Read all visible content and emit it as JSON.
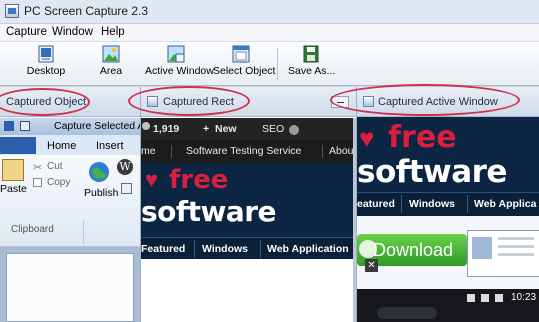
{
  "window": {
    "title": "PC Screen Capture 2.3"
  },
  "menu": {
    "items": [
      "Capture",
      "Window",
      "Help"
    ]
  },
  "toolbar": {
    "desktop_label": "Desktop",
    "area_label": "Area",
    "active_window_label": "Active Window",
    "select_object_label": "Select Object",
    "save_as_label": "Save As..."
  },
  "panels": {
    "captured_object": {
      "header": "Captured Object",
      "word": {
        "title": "Capture Selected A",
        "tabs": [
          "Home",
          "Insert"
        ],
        "clipboard": {
          "paste": "Paste",
          "cut": "Cut",
          "copy": "Copy",
          "group": "Clipboard"
        },
        "publish": "Publish"
      }
    },
    "captured_rect": {
      "header": "Captured Rect",
      "site": {
        "top": {
          "count": "1,919",
          "new": "New",
          "seo": "SEO"
        },
        "nav": [
          "me",
          "Software Testing Service",
          "Abou"
        ],
        "logo_free": "free",
        "logo_software": "software",
        "nav2": [
          "Featured",
          "Windows",
          "Web Application"
        ]
      }
    },
    "captured_active_window": {
      "header": "Captured Active Window",
      "site": {
        "logo_free": "free",
        "logo_software": "software",
        "nav2": [
          "eatured",
          "Windows",
          "Web Applica"
        ],
        "download": "Download",
        "time": "10:23"
      }
    }
  },
  "colors": {
    "highlight": "#d0304b",
    "brand_red": "#d8203e",
    "site_navy": "#0c2543",
    "download_green": "#3fae2f"
  },
  "icons": [
    "app-icon",
    "desktop-icon",
    "area-icon",
    "active-window-icon",
    "select-object-icon",
    "save-icon",
    "scissors-icon",
    "copy-icon",
    "paste-icon",
    "globe-icon",
    "wordpress-icon",
    "heart-icon"
  ]
}
